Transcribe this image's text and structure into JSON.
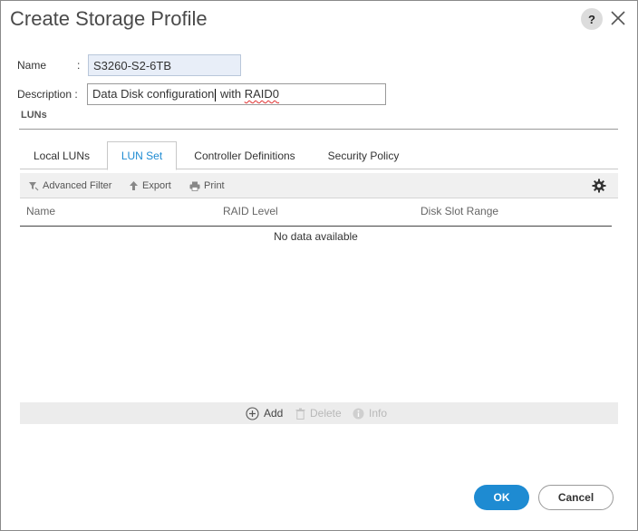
{
  "dialog": {
    "title": "Create Storage Profile",
    "help_label": "?"
  },
  "form": {
    "name_label": "Name",
    "name_colon": ":",
    "name_value": "S3260-S2-6TB",
    "description_label": "Description :",
    "description_before_caret": "Data Disk configuration",
    "description_after_caret": " with ",
    "description_misspelled": "RAID0"
  },
  "section": {
    "title": "LUNs"
  },
  "tabs": [
    {
      "label": "Local LUNs",
      "active": false
    },
    {
      "label": "LUN Set",
      "active": true
    },
    {
      "label": "Controller Definitions",
      "active": false
    },
    {
      "label": "Security Policy",
      "active": false
    }
  ],
  "toolbar": {
    "advanced_filter": "Advanced Filter",
    "export": "Export",
    "print": "Print"
  },
  "table": {
    "columns": [
      "Name",
      "RAID Level",
      "Disk Slot Range"
    ],
    "empty_message": "No data available"
  },
  "footer_actions": {
    "add": "Add",
    "delete": "Delete",
    "info": "Info"
  },
  "buttons": {
    "ok": "OK",
    "cancel": "Cancel"
  },
  "colors": {
    "accent": "#1e8bd2",
    "disabled_text": "#b8b8b8"
  }
}
